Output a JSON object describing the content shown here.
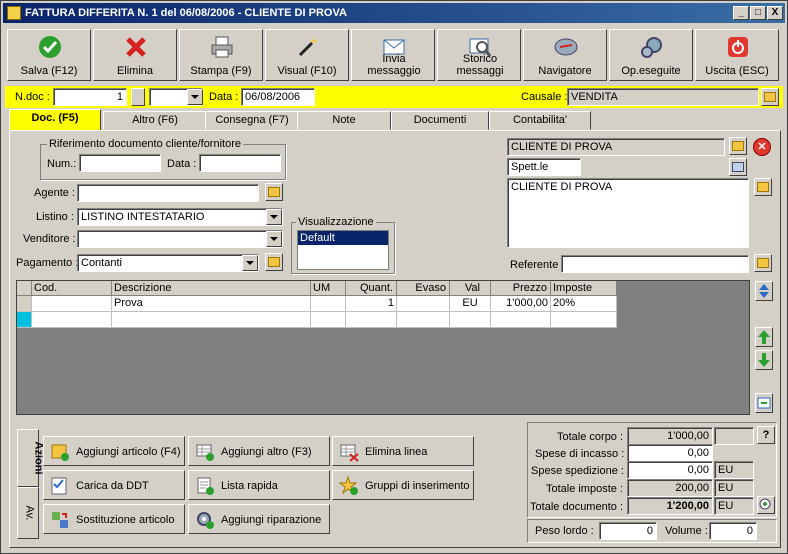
{
  "window": {
    "title": "FATTURA DIFFERITA N. 1  del 06/08/2006 - CLIENTE DI PROVA",
    "min": "_",
    "max": "□",
    "close": "X"
  },
  "toolbar": {
    "buttons": [
      {
        "label": "Salva (F12)",
        "icon": "check-icon",
        "color": "#2ca02c"
      },
      {
        "label": "Elimina",
        "icon": "x-icon",
        "color": "#d62020"
      },
      {
        "label": "Stampa (F9)",
        "icon": "printer-icon",
        "color": "#808080"
      },
      {
        "label": "Visual (F10)",
        "icon": "wand-icon",
        "color": "#000000"
      },
      {
        "label": "Invia messaggio",
        "icon": "mail-icon",
        "color": "#3a6ea5"
      },
      {
        "label": "Storico messaggi",
        "icon": "search-mail-icon",
        "color": "#3a6ea5"
      },
      {
        "label": "Navigatore",
        "icon": "compass-icon",
        "color": "#6a8ab5"
      },
      {
        "label": "Op.eseguite",
        "icon": "gears-icon",
        "color": "#6a8ab5"
      },
      {
        "label": "Uscita (ESC)",
        "icon": "power-icon",
        "color": "#e0382e"
      }
    ]
  },
  "header": {
    "ndoc_label": "N.doc :",
    "ndoc_value": "1",
    "data_label": "Data :",
    "data_value": "06/08/2006",
    "causale_label": "Causale :",
    "causale_value": "VENDITA"
  },
  "tabs": [
    "Doc. (F5)",
    "Altro (F6)",
    "Consegna (F7)",
    "Note",
    "Documenti",
    "Contabilita'"
  ],
  "riferimento": {
    "title": "Riferimento documento cliente/fornitore",
    "num_label": "Num.:",
    "data_label": "Data :",
    "num_value": "",
    "data_value": ""
  },
  "fields": {
    "agente_label": "Agente :",
    "agente_value": "",
    "listino_label": "Listino :",
    "listino_value": "LISTINO INTESTATARIO",
    "venditore_label": "Venditore :",
    "venditore_value": "",
    "pagamento_label": "Pagamento :",
    "pagamento_value": "Contanti"
  },
  "visualizzazione": {
    "title": "Visualizzazione",
    "items": [
      "Default"
    ]
  },
  "cliente": {
    "name": "CLIENTE DI PROVA",
    "title": "Spett.le",
    "address": "CLIENTE DI PROVA",
    "referente_label": "Referente :",
    "referente_value": ""
  },
  "grid": {
    "headers": [
      "Cod.",
      "Descrizione",
      "UM",
      "Quant.",
      "Evaso",
      "Val",
      "Prezzo",
      "Imposte"
    ],
    "rows": [
      [
        "",
        "Prova",
        "",
        "1",
        "",
        "EU",
        "1'000,00",
        "20%"
      ],
      [
        "",
        "",
        "",
        "",
        "",
        "",
        "",
        ""
      ]
    ]
  },
  "actions": {
    "vtabs": [
      "Azioni",
      "Av."
    ],
    "buttons": [
      {
        "label": "Aggiungi articolo (F4)",
        "icon": "box-add-icon"
      },
      {
        "label": "Aggiungi altro (F3)",
        "icon": "grid-add-icon"
      },
      {
        "label": "Elimina linea",
        "icon": "grid-delete-icon"
      },
      {
        "label": "Carica da DDT",
        "icon": "checklist-icon"
      },
      {
        "label": "Lista rapida",
        "icon": "list-add-icon"
      },
      {
        "label": "Gruppi di inserimento",
        "icon": "star-add-icon"
      },
      {
        "label": "Sostituzione articolo",
        "icon": "swap-icon"
      },
      {
        "label": "Aggiungi riparazione",
        "icon": "gear-add-icon"
      }
    ]
  },
  "totals": {
    "corpo_label": "Totale corpo :",
    "corpo_value": "1'000,00",
    "help": "?",
    "incasso_label": "Spese di incasso :",
    "incasso_value": "0,00",
    "spedizione_label": "Spese spedizione :",
    "spedizione_value": "0,00",
    "spedizione_cur": "EU",
    "imposte_label": "Totale imposte :",
    "imposte_value": "200,00",
    "imposte_cur": "EU",
    "documento_label": "Totale documento :",
    "documento_value": "1'200,00",
    "documento_cur": "EU",
    "peso_label": "Peso lordo :",
    "peso_value": "0",
    "volume_label": "Volume :",
    "volume_value": "0"
  }
}
